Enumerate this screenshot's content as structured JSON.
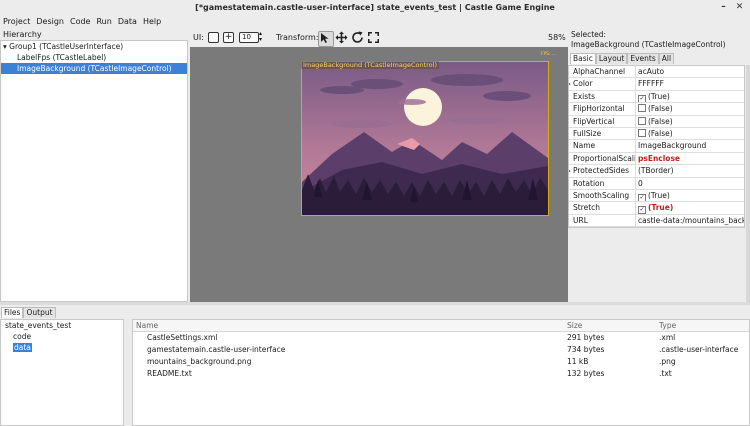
{
  "window": {
    "title": "[*gamestatemain.castle-user-interface] state_events_test | Castle Game Engine",
    "minimize_glyph": "–",
    "close_glyph": "✕"
  },
  "menu": [
    "Project",
    "Design",
    "Code",
    "Run",
    "Data",
    "Help"
  ],
  "hierarchy": {
    "title": "Hierarchy",
    "items": [
      {
        "label": "Group1 (TCastleUserInterface)",
        "expander": "▾"
      },
      {
        "label": "LabelFps (TCastleLabel)"
      },
      {
        "label": "ImageBackground (TCastleImageControl)"
      }
    ]
  },
  "toolbar": {
    "ui_label": "UI:",
    "spin_value": "10",
    "transform_label": "Transform:",
    "zoom": "58%"
  },
  "viewport": {
    "image_label": "ImageBackground (TCastleImageControl)",
    "fps_label": "FPS: ..."
  },
  "inspector": {
    "selected_label": "Selected:",
    "selected_value": "ImageBackground (TCastleImageControl)",
    "tabs": [
      "Basic",
      "Layout",
      "Events",
      "All"
    ],
    "properties": [
      {
        "name": "AlphaChannel",
        "value": "acAuto"
      },
      {
        "name": "Color",
        "value": "FFFFFF",
        "expander": "▸"
      },
      {
        "name": "Exists",
        "value": "(True)",
        "check": "✓"
      },
      {
        "name": "FlipHorizontal",
        "value": "(False)",
        "check": ""
      },
      {
        "name": "FlipVertical",
        "value": "(False)",
        "check": ""
      },
      {
        "name": "FullSize",
        "value": "(False)",
        "check": ""
      },
      {
        "name": "Name",
        "value": "ImageBackground"
      },
      {
        "name": "ProportionalScaling",
        "value": "psEnclose",
        "red": true
      },
      {
        "name": "ProtectedSides",
        "value": "(TBorder)",
        "expander": "▸"
      },
      {
        "name": "Rotation",
        "value": "0"
      },
      {
        "name": "SmoothScaling",
        "value": "(True)",
        "check": "✓"
      },
      {
        "name": "Stretch",
        "value": "(True)",
        "check": "✓",
        "red": true
      },
      {
        "name": "URL",
        "value": "castle-data:/mountains_background.png"
      }
    ]
  },
  "bottom": {
    "tabs": [
      "Files",
      "Output"
    ],
    "tree": [
      {
        "label": "state_events_test"
      },
      {
        "label": "code"
      },
      {
        "label": "data",
        "selected": true
      }
    ],
    "columns": [
      "Name",
      "Size",
      "Type"
    ],
    "files": [
      {
        "name": "CastleSettings.xml",
        "size": "291 bytes",
        "type": ".xml"
      },
      {
        "name": "gamestatemain.castle-user-interface",
        "size": "734 bytes",
        "type": ".castle-user-interface"
      },
      {
        "name": "mountains_background.png",
        "size": "11 kB",
        "type": ".png"
      },
      {
        "name": "README.txt",
        "size": "132 bytes",
        "type": ".txt"
      }
    ]
  }
}
